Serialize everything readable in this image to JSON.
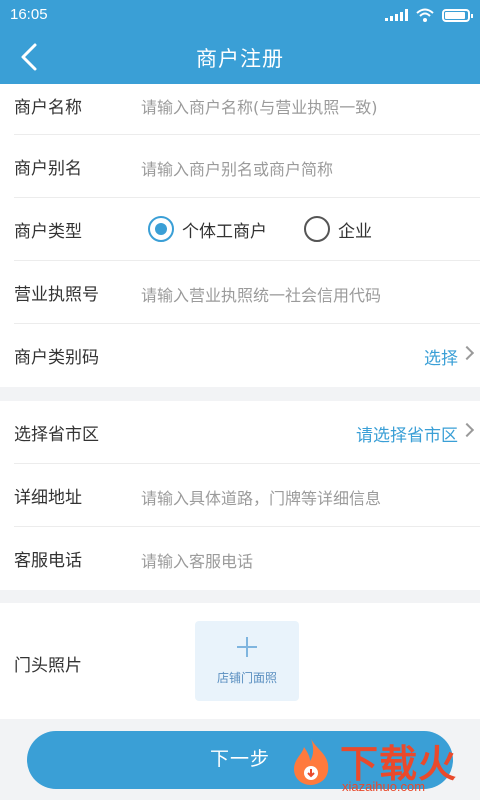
{
  "status_bar": {
    "time": "16:05"
  },
  "header": {
    "title": "商户注册",
    "back_icon": "back-arrow-icon"
  },
  "form": {
    "merchant_name": {
      "label": "商户名称",
      "placeholder": "请输入商户名称(与营业执照一致)"
    },
    "merchant_alias": {
      "label": "商户别名",
      "placeholder": "请输入商户别名或商户简称"
    },
    "merchant_type": {
      "label": "商户类型",
      "options": [
        {
          "label": "个体工商户",
          "selected": true
        },
        {
          "label": "企业",
          "selected": false
        }
      ]
    },
    "license_no": {
      "label": "营业执照号",
      "placeholder": "请输入营业执照统一社会信用代码"
    },
    "category_code": {
      "label": "商户类别码",
      "action": "选择"
    },
    "region": {
      "label": "选择省市区",
      "action": "请选择省市区"
    },
    "address": {
      "label": "详细地址",
      "placeholder": "请输入具体道路，门牌等详细信息"
    },
    "phone": {
      "label": "客服电话",
      "placeholder": "请输入客服电话"
    },
    "storefront_photo": {
      "label": "门头照片",
      "upload_caption": "店铺门面照"
    }
  },
  "footer": {
    "next_label": "下一步"
  },
  "watermark": {
    "brand": "下载火",
    "url": "xiazaihuo.com"
  },
  "colors": {
    "accent": "#3a9fd6",
    "watermark": "#e94a2c"
  }
}
